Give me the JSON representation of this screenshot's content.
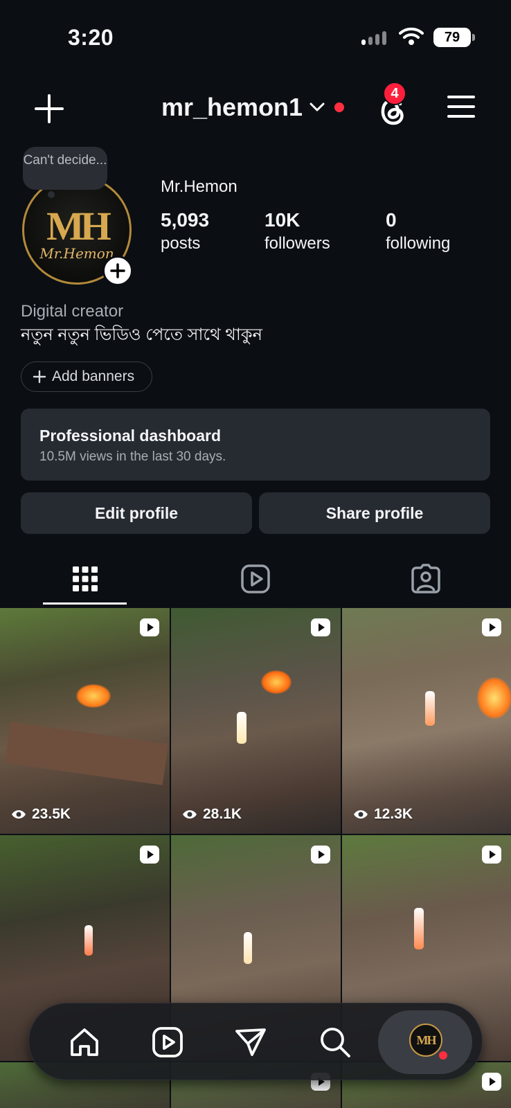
{
  "status_bar": {
    "time": "3:20",
    "battery": "79"
  },
  "header": {
    "username": "mr_hemon1",
    "notification_count": "4"
  },
  "profile": {
    "note": "Can't decide...",
    "avatar_monogram": "MH",
    "avatar_signature": "Mr.Hemon",
    "display_name": "Mr.Hemon",
    "stats": [
      {
        "value": "5,093",
        "label": "posts"
      },
      {
        "value": "10K",
        "label": "followers"
      },
      {
        "value": "0",
        "label": "following"
      }
    ],
    "category": "Digital creator",
    "bio": "নতুন নতুন ভিডিও পেতে সাথে থাকুন"
  },
  "add_banners_label": "Add banners",
  "dashboard": {
    "title": "Professional dashboard",
    "subtitle": "10.5M views in the last 30 days."
  },
  "buttons": {
    "edit": "Edit profile",
    "share": "Share profile"
  },
  "posts": [
    {
      "views": "23.5K"
    },
    {
      "views": "28.1K"
    },
    {
      "views": "12.3K"
    },
    {
      "views": ""
    },
    {
      "views": ""
    },
    {
      "views": ""
    }
  ],
  "colors": {
    "background": "#0b0f14",
    "card": "#262a31",
    "accent_red": "#ff2f3f",
    "gold": "#d7a84f"
  },
  "icons": [
    "plus-icon",
    "chevron-down-icon",
    "threads-icon",
    "menu-icon",
    "grid-icon",
    "reels-icon",
    "tagged-icon",
    "eye-icon",
    "home-icon",
    "send-icon",
    "search-icon"
  ]
}
